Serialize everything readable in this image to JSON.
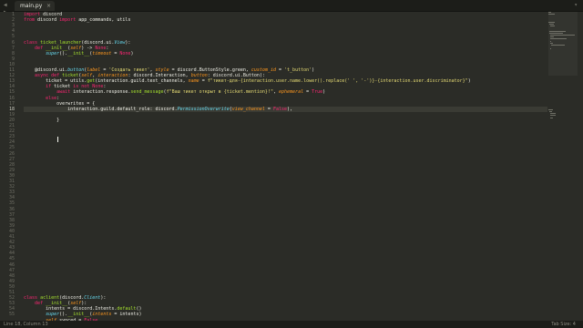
{
  "tabbar": {
    "tab_label": "main.py",
    "arrow_glyph": "◀ ▶",
    "close_glyph": "×",
    "menu_glyph": "▾"
  },
  "gutter": {
    "line_numbers": [
      "1",
      "2",
      "3",
      "4",
      "5",
      "6",
      "7",
      "8",
      "9",
      "10",
      "11",
      "12",
      "13",
      "14",
      "15",
      "16",
      "17",
      "18",
      "19",
      "20",
      "21",
      "22",
      "23",
      "24",
      "25",
      "26",
      "27",
      "28",
      "29",
      "30",
      "31",
      "32",
      "33",
      "34",
      "35",
      "36",
      "37",
      "38",
      "39",
      "40",
      "41",
      "42",
      "43",
      "44",
      "45",
      "46",
      "47",
      "48",
      "49",
      "50",
      "51",
      "52",
      "53",
      "54",
      "55"
    ],
    "active_line": "18"
  },
  "editor": {
    "lines": [
      "[[kw:import]] discord",
      "[[kw:from]] discord [[kw:import]] app_commands, utils",
      "",
      "",
      "",
      "[[kw:class]] [[fn:ticket_launcher]](discord.ui.[[cls:View]]):",
      "    [[kw:def]] [[fn:__init__]]([[pm:self]]) -> [[kw:None]]:",
      "        [[cls:super]]().[[fn:__init__]]([[pm:timeout]] = [[kw:None]])",
      "",
      "",
      "    @discord.ui.[[cls:button]]([[pm:label]] = [[st:'Создать тикет']], [[pm:style]] = discord.ButtonStyle.green, [[pm:custom_id]] = [[st:'t_button']])",
      "    [[kw:async def]] [[fn:ticket]]([[pm:self]], [[pm:interaction]]: discord.Interaction, [[pm:button]]: discord.ui.Button):",
      "        ticket = utils.[[fn:get]](interaction.guild.text_channels, [[pm:name]] = [[st:f\"тикет-для-{interaction.user.name.lower().replace(' ', '-')}-{interaction.user.discriminator}\"]])",
      "        [[kw:if]] ticket [[kw:is not]] [[kw:None]]:",
      "            [[kw:await]] interaction.response.[[fn:send_message]]([[st:f\"Ваш тикет открыт в {ticket.mention}!\"]], [[pm:ephemeral]] = [[kw:True]])",
      "        [[kw:else]]:",
      "            overwrites = {",
      "                interaction.guild.default_role: discord.[[cls:PermissionOverwrite]]([[pm:view_channel]] = [[kw:False]]),",
      "                ",
      "            }",
      "",
      "",
      "",
      "",
      "",
      "",
      "",
      "",
      "",
      "",
      "",
      "",
      "",
      "",
      "",
      "",
      "",
      "",
      "",
      "",
      "",
      "",
      "",
      "",
      "",
      "",
      "",
      "",
      "",
      "",
      "",
      "[[kw:class]] [[fn:aclient]](discord.[[cls:Client]]):",
      "    [[kw:def]] [[fn:__init__]]([[pm:self]]):",
      "        intents = discord.Intents.[[fn:default]]()",
      "        [[cls:super]]().[[fn:__init__]]([[pm:intents]] = intents)",
      "        [[pm:self]].synced = [[kw:False]]"
    ]
  },
  "statusbar": {
    "left": "Line 18, Column 13",
    "right": "Tab Size: 4"
  },
  "colors": {
    "background": "#2b2c27",
    "keyword": "#f92672",
    "function": "#a6e22e",
    "string": "#e6db74"
  }
}
